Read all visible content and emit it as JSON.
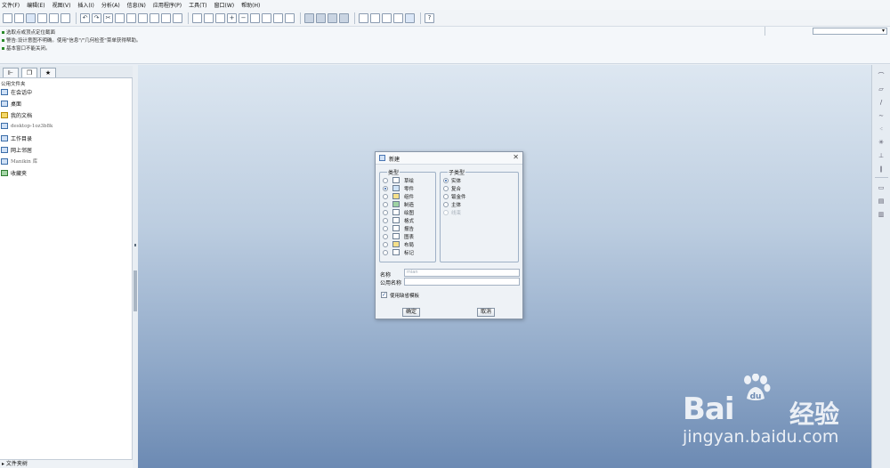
{
  "menu": [
    "文件(F)",
    "编辑(E)",
    "视图(V)",
    "插入(I)",
    "分析(A)",
    "信息(N)",
    "应用程序(P)",
    "工具(T)",
    "窗口(W)",
    "帮助(H)"
  ],
  "messages": [
    "选取点或顶点定位截面",
    "警告:设计意图不明确。使用\"信息\"/\"几何检查\"菜单获得帮助。",
    "基本窗口不能关闭。"
  ],
  "navigator": {
    "folder_title": "公用文件夹",
    "items": [
      {
        "label": "在会话中",
        "icon": "session-icon"
      },
      {
        "label": "桌面",
        "icon": "desktop-icon"
      },
      {
        "label": "我的文档",
        "icon": "documents-icon"
      },
      {
        "label": "desktop-1oz3b8k",
        "icon": "computer-icon"
      },
      {
        "label": "工作目录",
        "icon": "working-dir-icon"
      },
      {
        "label": "网上邻居",
        "icon": "network-icon"
      },
      {
        "label": "Manikin 库",
        "icon": "manikin-icon"
      },
      {
        "label": "收藏夹",
        "icon": "favorites-icon"
      }
    ],
    "footer": "▸ 文件夹树"
  },
  "dialog": {
    "title": "新建",
    "type_label": "类型",
    "types": [
      "草绘",
      "零件",
      "组件",
      "制造",
      "绘图",
      "格式",
      "报告",
      "图表",
      "布局",
      "标记"
    ],
    "type_selected": 1,
    "subtype_label": "子类型",
    "subtypes": [
      "实体",
      "复合",
      "钣金件",
      "主体",
      "线束"
    ],
    "subtype_selected": 0,
    "subtype_disabled": [
      4
    ],
    "name_label": "名称",
    "name_value": "mian",
    "common_name_label": "公用名称",
    "common_name_value": "",
    "use_template_label": "使用缺省模板",
    "use_template_checked": true,
    "ok_label": "确定",
    "cancel_label": "取消"
  },
  "watermark": {
    "brand_latin": "Bai",
    "brand_cn": "经验",
    "url": "jingyan.baidu.com"
  },
  "colors": {
    "accent": "#2a5ea8",
    "background_top": "#dde7f1",
    "background_bottom": "#6c8ab3"
  }
}
